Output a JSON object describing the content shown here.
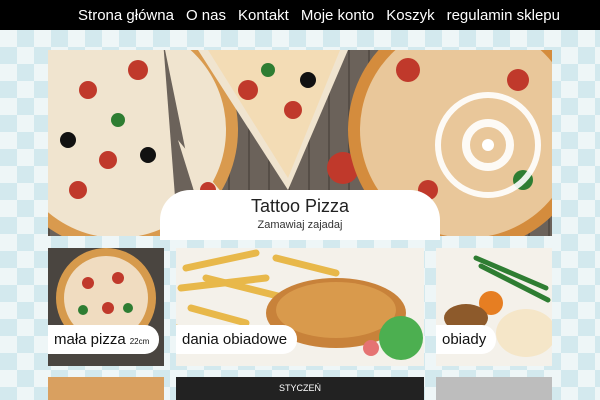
{
  "nav": {
    "items": [
      {
        "label": "Strona główna"
      },
      {
        "label": "O nas"
      },
      {
        "label": "Kontakt"
      },
      {
        "label": "Moje konto"
      },
      {
        "label": "Koszyk"
      },
      {
        "label": "regulamin sklepu"
      }
    ]
  },
  "hero": {
    "title": "Tattoo Pizza",
    "subtitle": "Zamawiaj zajadaj",
    "logo_text": "TATTOO-PIZZA ZAMAWIAJ-ZAJADAJ",
    "slides_total": 2,
    "slide_active": 1
  },
  "tiles": [
    {
      "label": "mała pizza",
      "note": "22cm"
    },
    {
      "label": "dania obiadowe"
    },
    {
      "label": "obiady"
    }
  ],
  "calendar": {
    "month": "STYCZEŃ"
  },
  "colors": {
    "topbar": "#000000",
    "accent": "#c0392b"
  }
}
